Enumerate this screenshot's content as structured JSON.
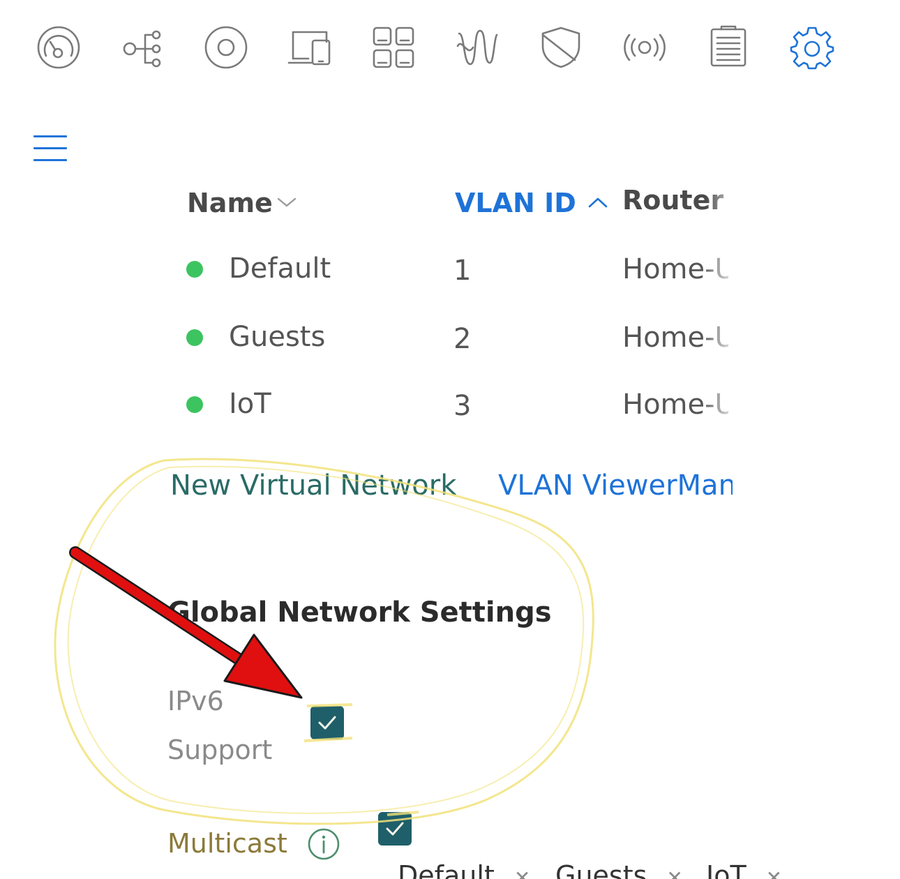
{
  "nav": {
    "items": [
      {
        "icon": "dashboard-gauge-icon",
        "active": false
      },
      {
        "icon": "topology-icon",
        "active": false
      },
      {
        "icon": "unifi-devices-icon",
        "active": false
      },
      {
        "icon": "client-devices-icon",
        "active": false
      },
      {
        "icon": "statistics-grid-icon",
        "active": false
      },
      {
        "icon": "traffic-insights-icon",
        "active": false
      },
      {
        "icon": "security-shield-icon",
        "active": false
      },
      {
        "icon": "wifi-broadcast-icon",
        "active": false
      },
      {
        "icon": "system-log-icon",
        "active": false
      },
      {
        "icon": "settings-gear-icon",
        "active": true
      }
    ],
    "menu_icon": "hamburger-menu-icon"
  },
  "table": {
    "columns": [
      {
        "label": "Name",
        "sort": "none"
      },
      {
        "label": "VLAN ID",
        "sort": "ascending"
      },
      {
        "label": "Router",
        "sort": "none"
      }
    ],
    "rows": [
      {
        "status": "online",
        "name": "Default",
        "vlan": "1",
        "router": "Home-UDM"
      },
      {
        "status": "online",
        "name": "Guests",
        "vlan": "2",
        "router": "Home-UDM"
      },
      {
        "status": "online",
        "name": "IoT",
        "vlan": "3",
        "router": "Home-UDM"
      }
    ]
  },
  "actions": {
    "new_network": "New Virtual Network",
    "vlan_viewer": "VLAN Viewer",
    "manage": "Manage"
  },
  "global_settings": {
    "title": "Global Network Settings",
    "ipv6": {
      "label_line1": "IPv6",
      "label_line2": "Support",
      "checked": true
    },
    "multicast": {
      "label": "Multicast",
      "checked": true
    },
    "multicast_chips": [
      "Default",
      "Guests",
      "IoT"
    ]
  },
  "colors": {
    "accent": "#1e73d8",
    "status_online": "#3cc460",
    "checkbox": "#1f5f6a",
    "annotation_arrow": "#e01010",
    "annotation_highlight": "#f2e27a"
  }
}
